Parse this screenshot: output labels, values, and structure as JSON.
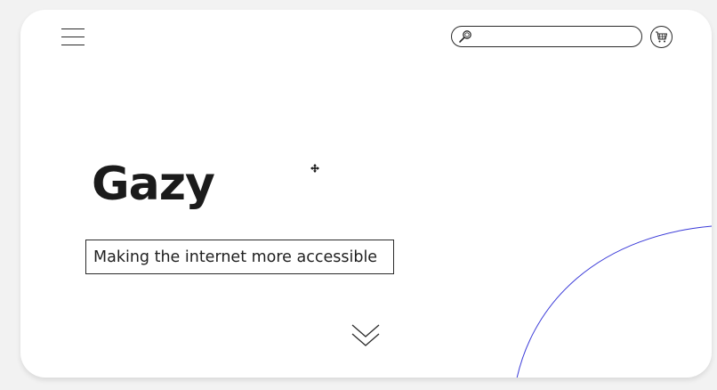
{
  "header": {
    "menu_icon": "hamburger-menu-icon",
    "search": {
      "icon": "magnifier-icon",
      "value": "",
      "placeholder": ""
    },
    "cart_icon": "shopping-cart-icon"
  },
  "hero": {
    "title": "Gazy",
    "tagline": "Making the internet more accessible"
  },
  "scroll_indicator_icon": "double-chevron-down-icon",
  "colors": {
    "background": "#f2f2f2",
    "card": "#ffffff",
    "text": "#1b1b1b",
    "decorative_curve": "#3a3ad8"
  }
}
